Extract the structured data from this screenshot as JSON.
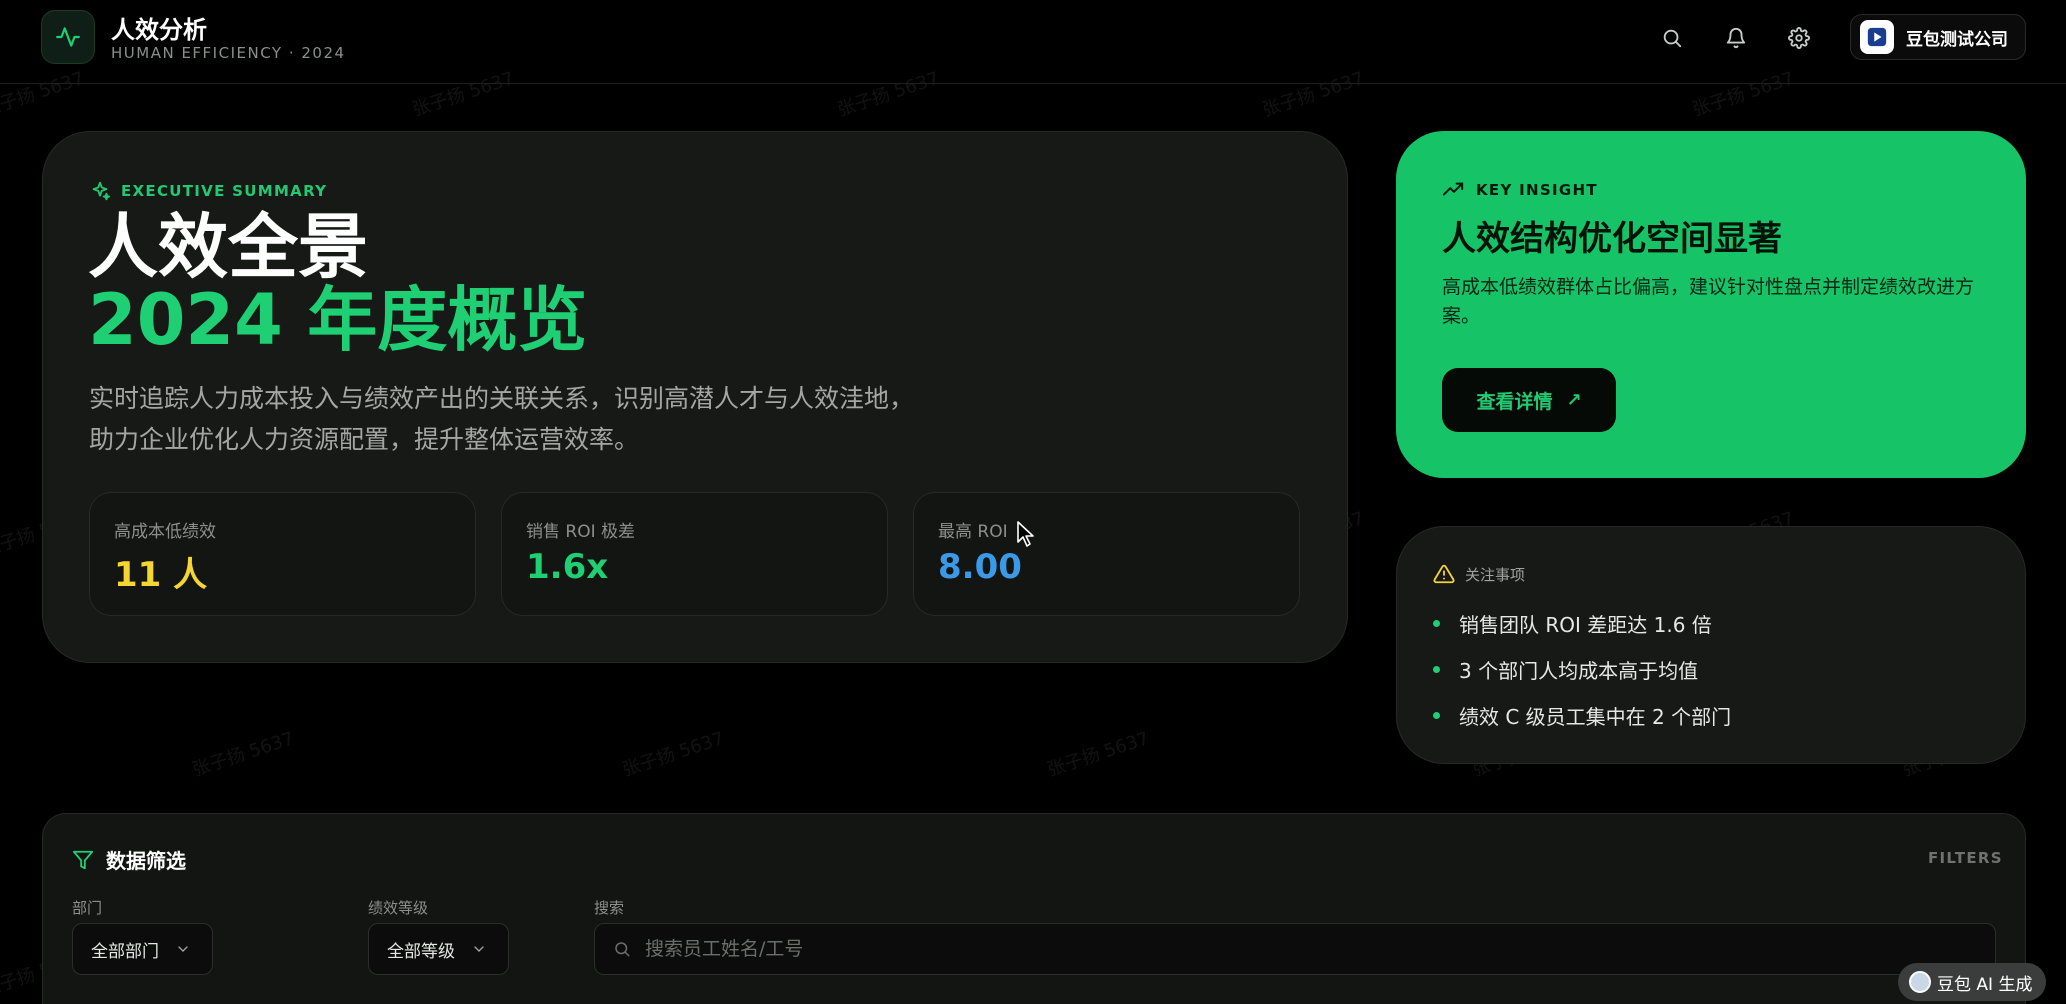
{
  "header": {
    "title": "人效分析",
    "subtitle": "HUMAN EFFICIENCY · 2024",
    "company": "豆包测试公司",
    "icons": [
      "search-icon",
      "bell-icon",
      "gear-icon"
    ]
  },
  "hero": {
    "label": "EXECUTIVE SUMMARY",
    "title_line1": "人效全景",
    "title_line2": "2024 年度概览",
    "description": "实时追踪人力成本投入与绩效产出的关联关系，识别高潜人才与人效洼地， 助力企业优化人力资源配置，提升整体运营效率。",
    "stats": [
      {
        "label": "高成本低绩效",
        "value": "11 人",
        "color": "#f5d531"
      },
      {
        "label": "销售 ROI 极差",
        "value": "1.6x",
        "color": "#1ecf74"
      },
      {
        "label": "最高 ROI",
        "value": "8.00",
        "color": "#3a9ae8"
      }
    ]
  },
  "insight": {
    "label": "KEY INSIGHT",
    "title": "人效结构优化空间显著",
    "description": "高成本低绩效群体占比偏高，建议针对性盘点并制定绩效改进方案。",
    "button": "查看详情"
  },
  "attention": {
    "label": "关注事项",
    "items": [
      "销售团队 ROI 差距达 1.6 倍",
      "3 个部门人均成本高于均值",
      "绩效 C 级员工集中在 2 个部门"
    ]
  },
  "filters": {
    "title": "数据筛选",
    "title_en": "FILTERS",
    "department_label": "部门",
    "department_value": "全部部门",
    "grade_label": "绩效等级",
    "grade_value": "全部等级",
    "search_label": "搜索",
    "search_placeholder": "搜索员工姓名/工号"
  },
  "watermark": "张子扬 5637",
  "ai_badge": "豆包 AI 生成",
  "colors": {
    "accent": "#1ecf74",
    "insight_bg": "#16c467"
  }
}
